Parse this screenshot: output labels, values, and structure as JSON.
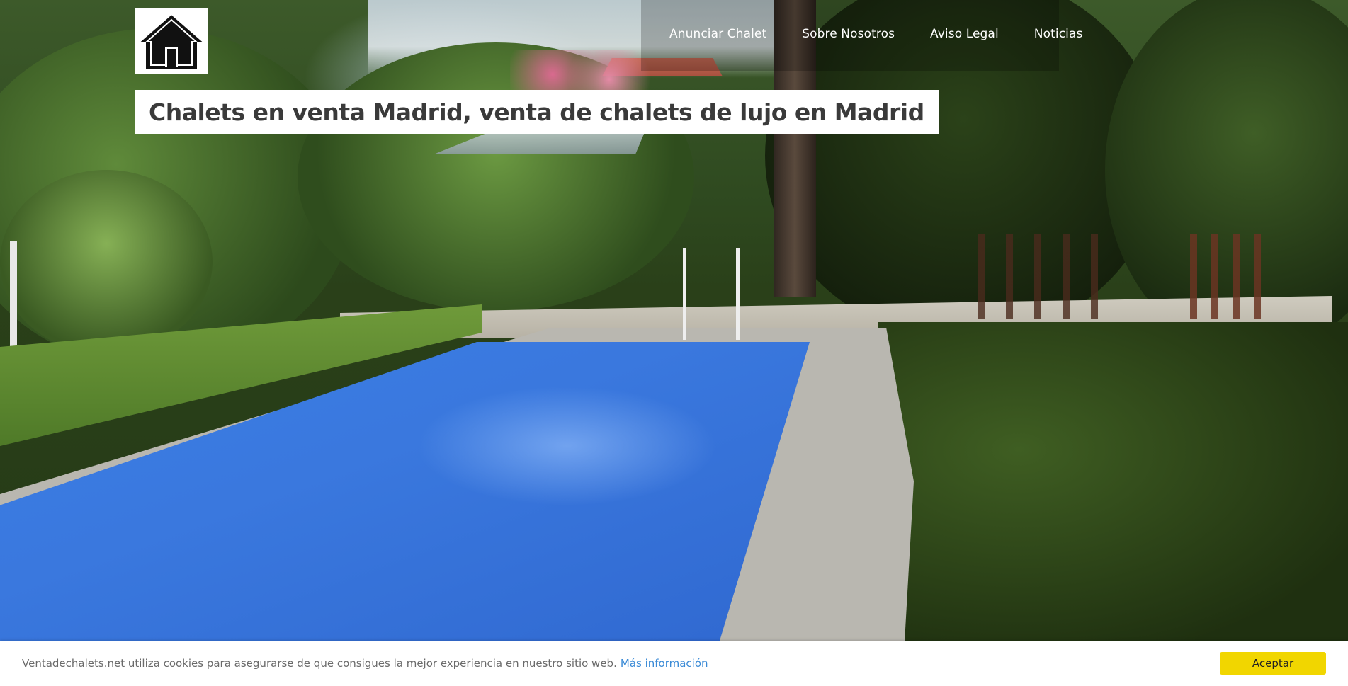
{
  "site": {
    "title": "Chalets en venta Madrid, venta de chalets de lujo en Madrid",
    "logo_icon": "house-icon"
  },
  "nav": {
    "items": [
      {
        "label": "Anunciar Chalet"
      },
      {
        "label": "Sobre Nosotros"
      },
      {
        "label": "Aviso Legal"
      },
      {
        "label": "Noticias"
      }
    ]
  },
  "cookie_bar": {
    "message": "Ventadechalets.net utiliza cookies para asegurarse de que consigues la mejor experiencia en nuestro sitio web.",
    "link_label": "Más información",
    "accept_label": "Aceptar",
    "button_color": "#f1d600",
    "link_color": "#3a8ad6"
  }
}
